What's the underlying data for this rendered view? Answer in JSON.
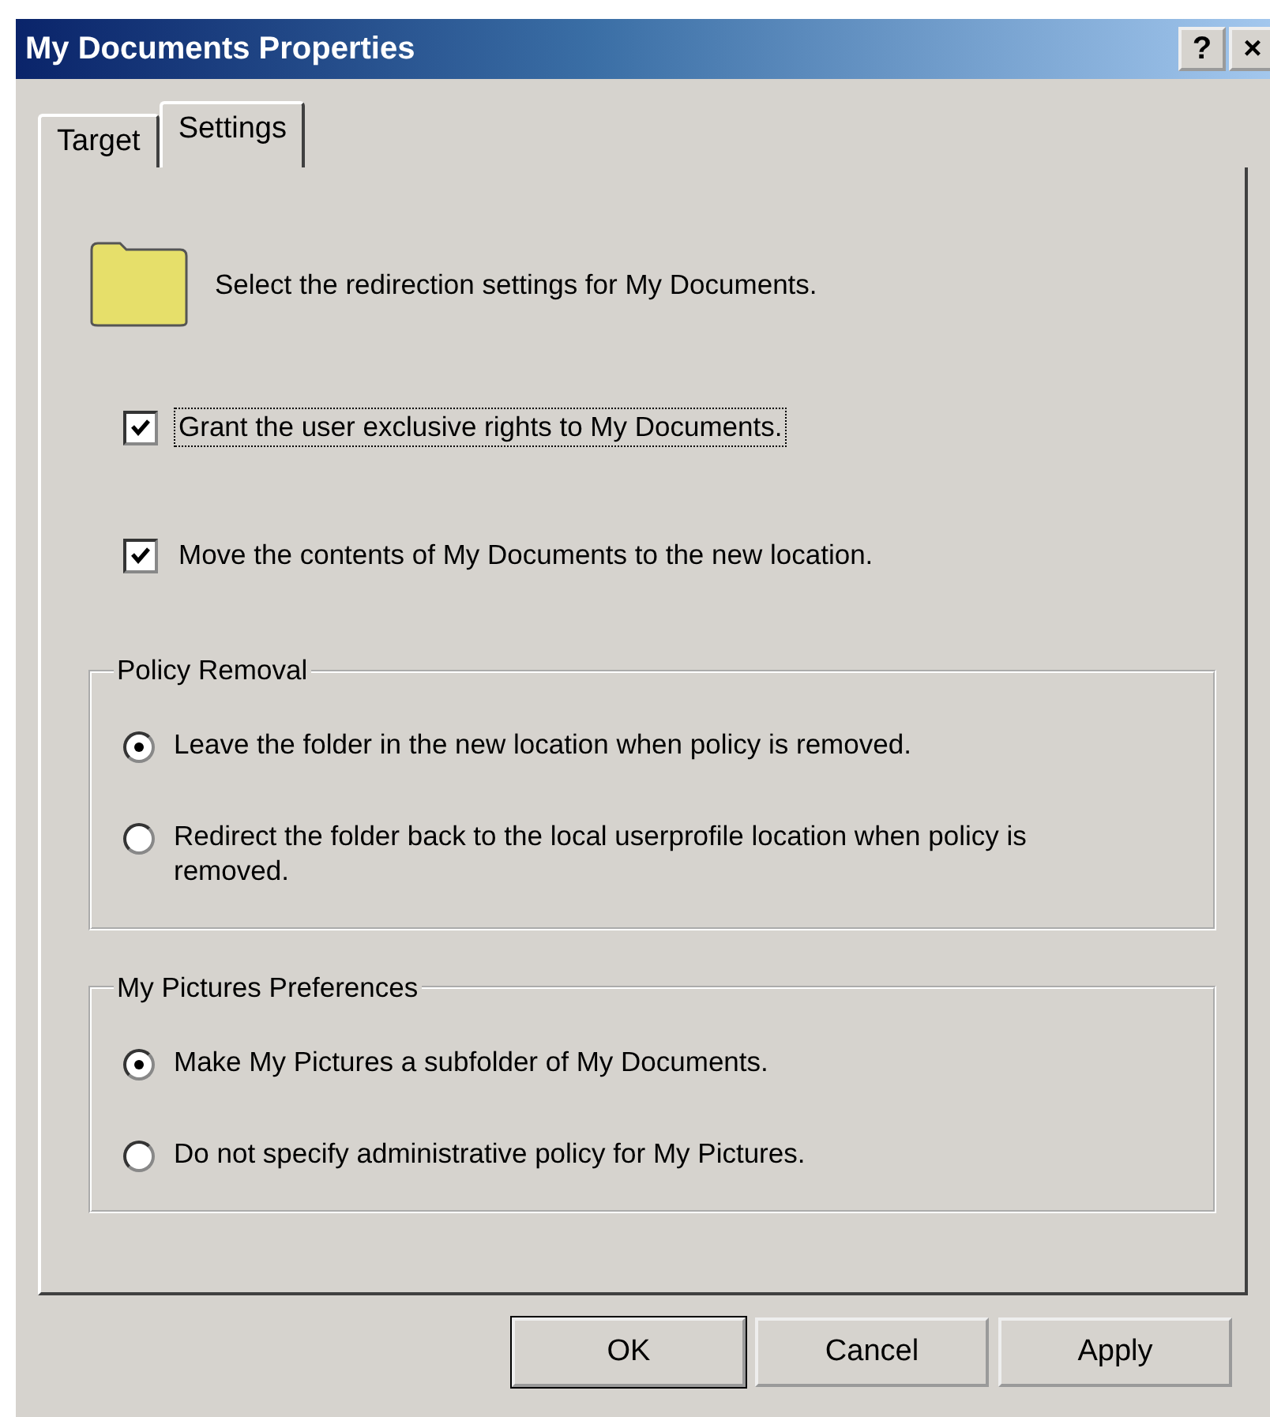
{
  "window": {
    "title": "My Documents Properties",
    "help_button": "?",
    "close_button": "×"
  },
  "tabs": [
    {
      "label": "Target",
      "selected": false
    },
    {
      "label": "Settings",
      "selected": true
    }
  ],
  "intro": "Select the redirection settings for My Documents.",
  "checkboxes": [
    {
      "label": "Grant the user exclusive rights to My Documents.",
      "checked": true,
      "focused": true
    },
    {
      "label": "Move the contents of My Documents to the new location.",
      "checked": true,
      "focused": false
    }
  ],
  "groups": [
    {
      "title": "Policy Removal",
      "options": [
        {
          "label": "Leave the folder in the new location when policy is removed.",
          "selected": true
        },
        {
          "label": "Redirect the folder back to the local userprofile location when policy is removed.",
          "selected": false
        }
      ]
    },
    {
      "title": "My Pictures Preferences",
      "options": [
        {
          "label": "Make My Pictures a subfolder of My Documents.",
          "selected": true
        },
        {
          "label": "Do not specify administrative policy for My Pictures.",
          "selected": false
        }
      ]
    }
  ],
  "buttons": [
    {
      "label": "OK",
      "default": true
    },
    {
      "label": "Cancel",
      "default": false
    },
    {
      "label": "Apply",
      "default": false
    }
  ]
}
